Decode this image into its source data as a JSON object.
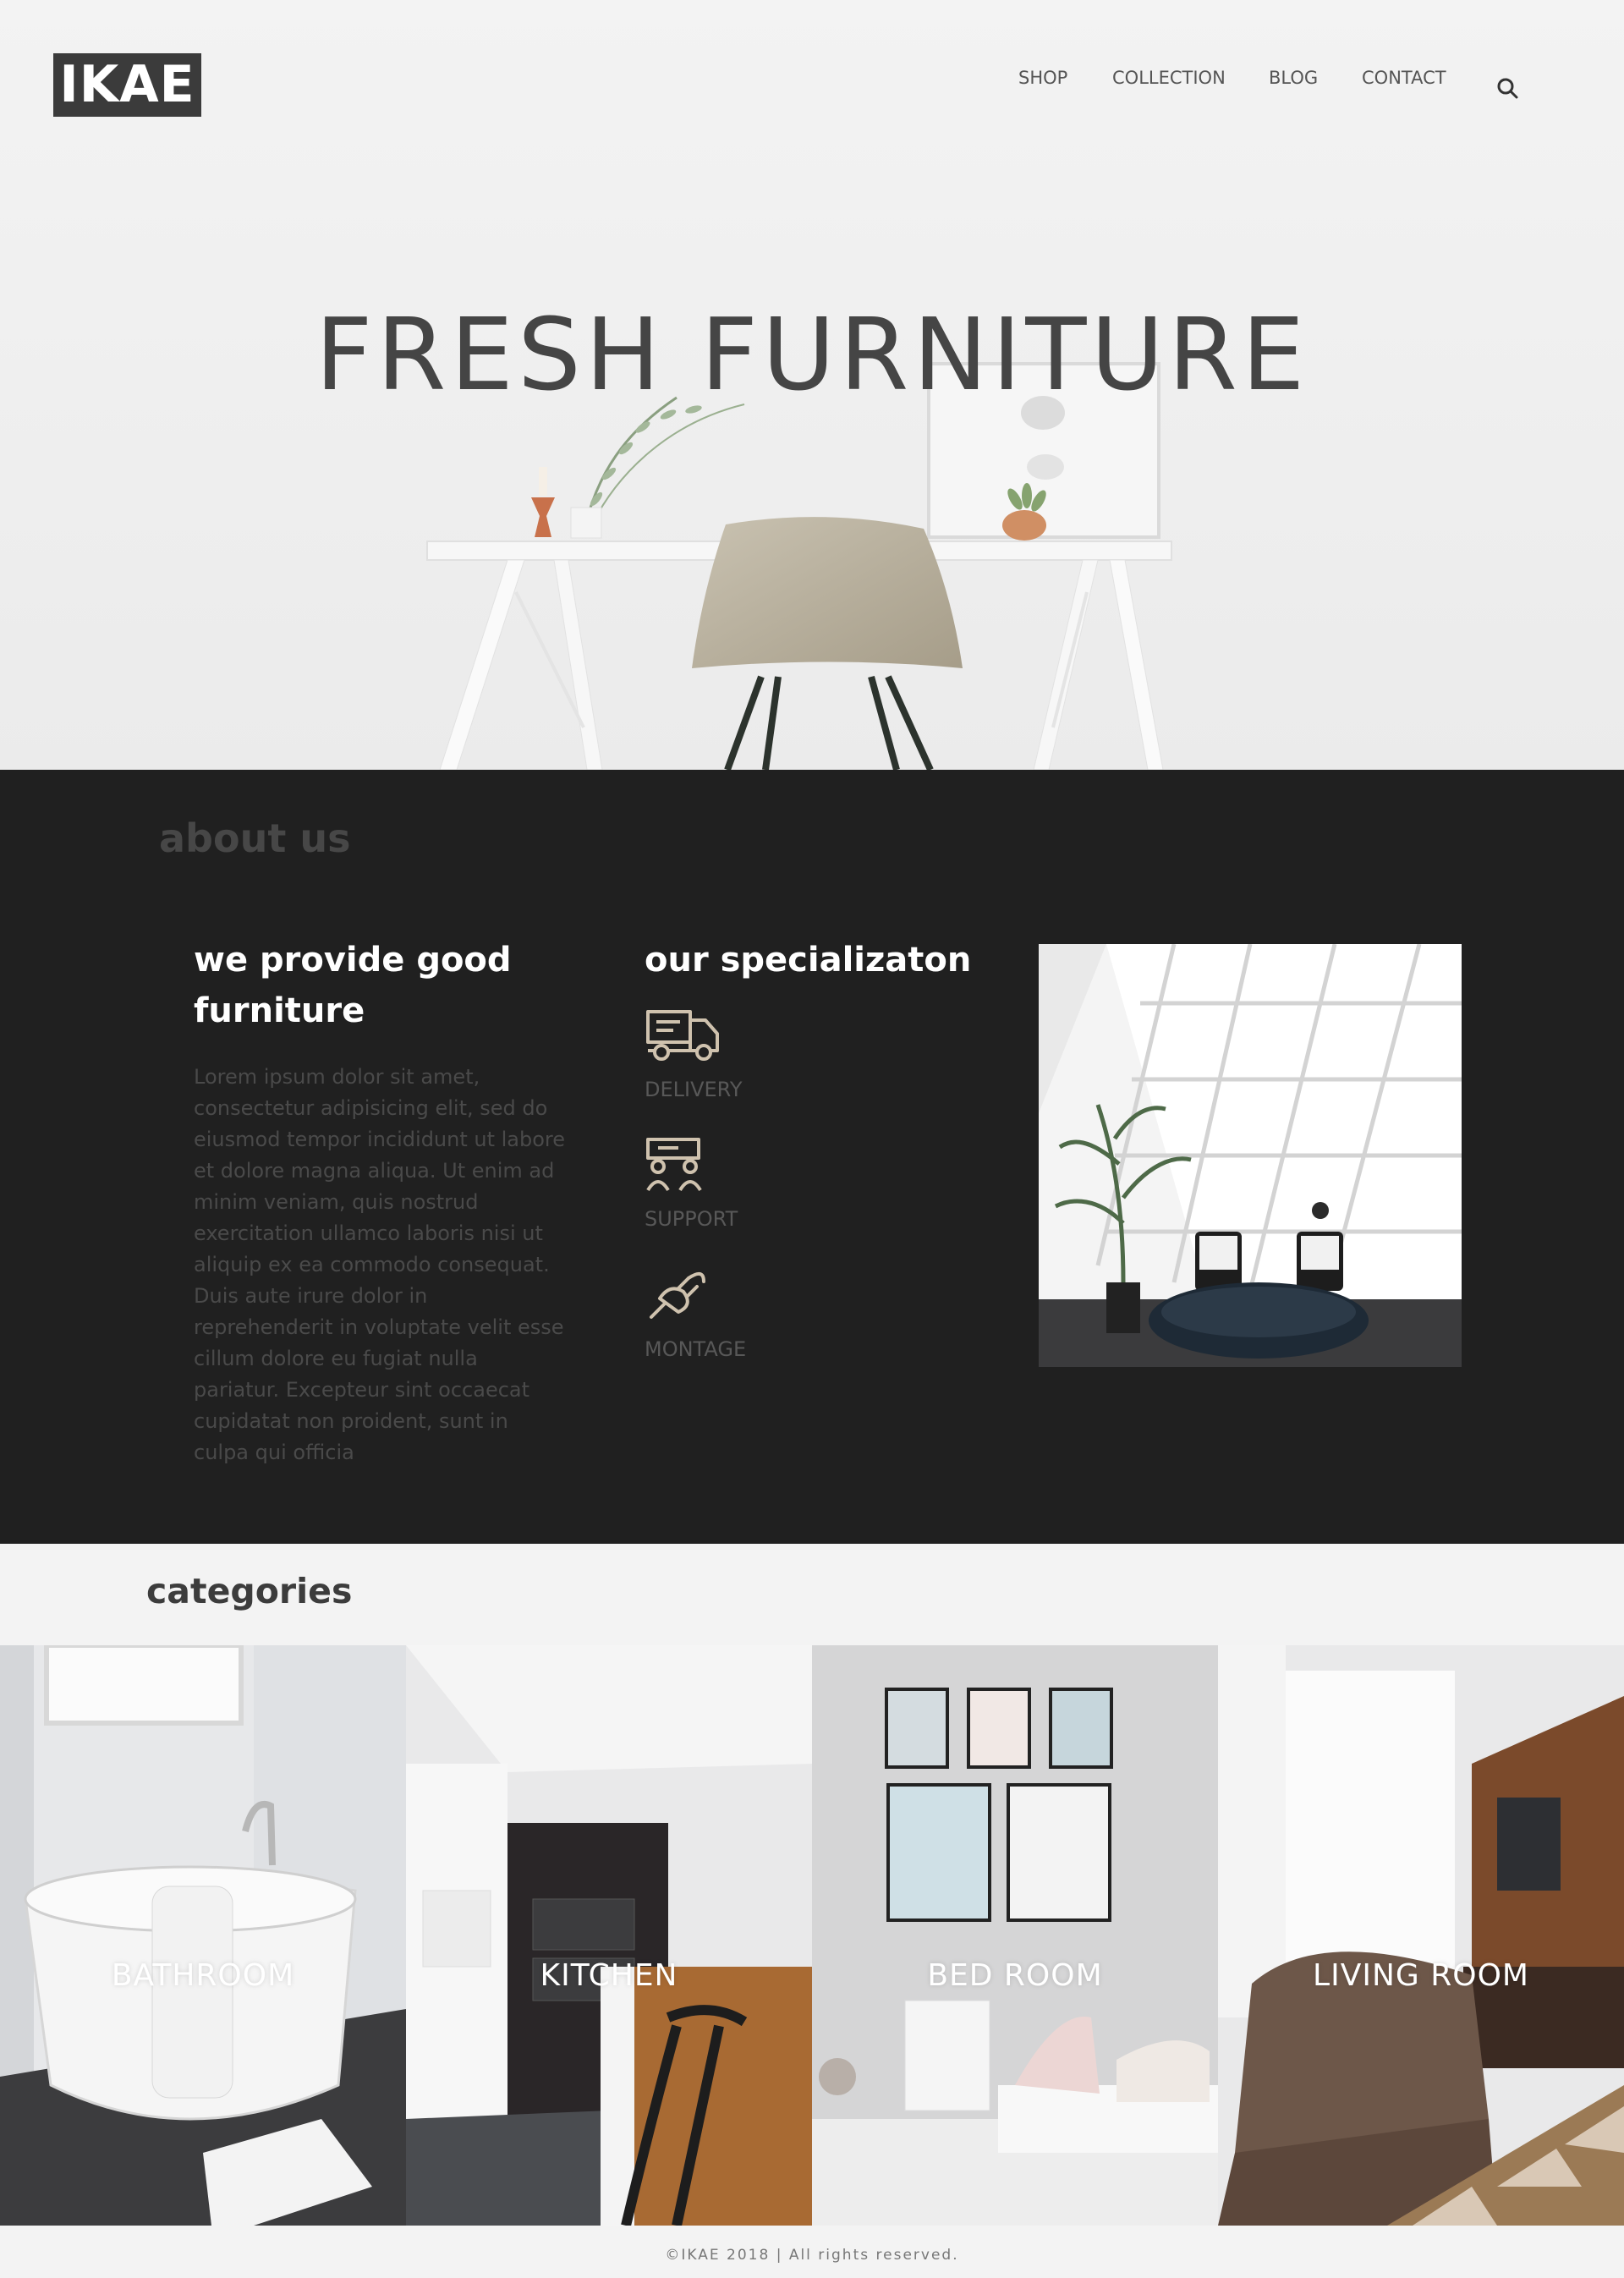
{
  "brand": {
    "logo": "IKAE"
  },
  "nav": {
    "items": [
      "SHOP",
      "COLLECTION",
      "BLOG",
      "CONTACT"
    ],
    "search_icon": "search-icon"
  },
  "hero": {
    "title": "FRESH FURNITURE"
  },
  "about": {
    "heading": "about us",
    "col1_title": "we provide good furniture",
    "col1_body": "Lorem ipsum dolor sit amet, consectetur adipisicing elit, sed do eiusmod tempor incididunt ut labore et dolore magna aliqua. Ut enim ad minim veniam, quis nostrud exercitation ullamco laboris nisi ut aliquip ex ea commodo consequat. Duis aute irure dolor in reprehenderit in voluptate velit esse cillum dolore eu fugiat nulla pariatur. Excepteur sint occaecat cupidatat non proident, sunt in culpa qui officia",
    "col2_title": "our specializaton",
    "specializations": [
      {
        "label": "DELIVERY",
        "icon": "truck-icon"
      },
      {
        "label": "SUPPORT",
        "icon": "support-icon"
      },
      {
        "label": "MONTAGE",
        "icon": "plug-icon"
      }
    ]
  },
  "categories": {
    "heading": "categories",
    "items": [
      "BATHROOM",
      "KITCHEN",
      "BED ROOM",
      "LIVING ROOM"
    ]
  },
  "footer": {
    "text": "©IKAE 2018 | All rights reserved."
  },
  "colors": {
    "dark_bg": "#202020",
    "accent_icon": "#cfc2ae",
    "light_bg": "#f3f3f3"
  }
}
